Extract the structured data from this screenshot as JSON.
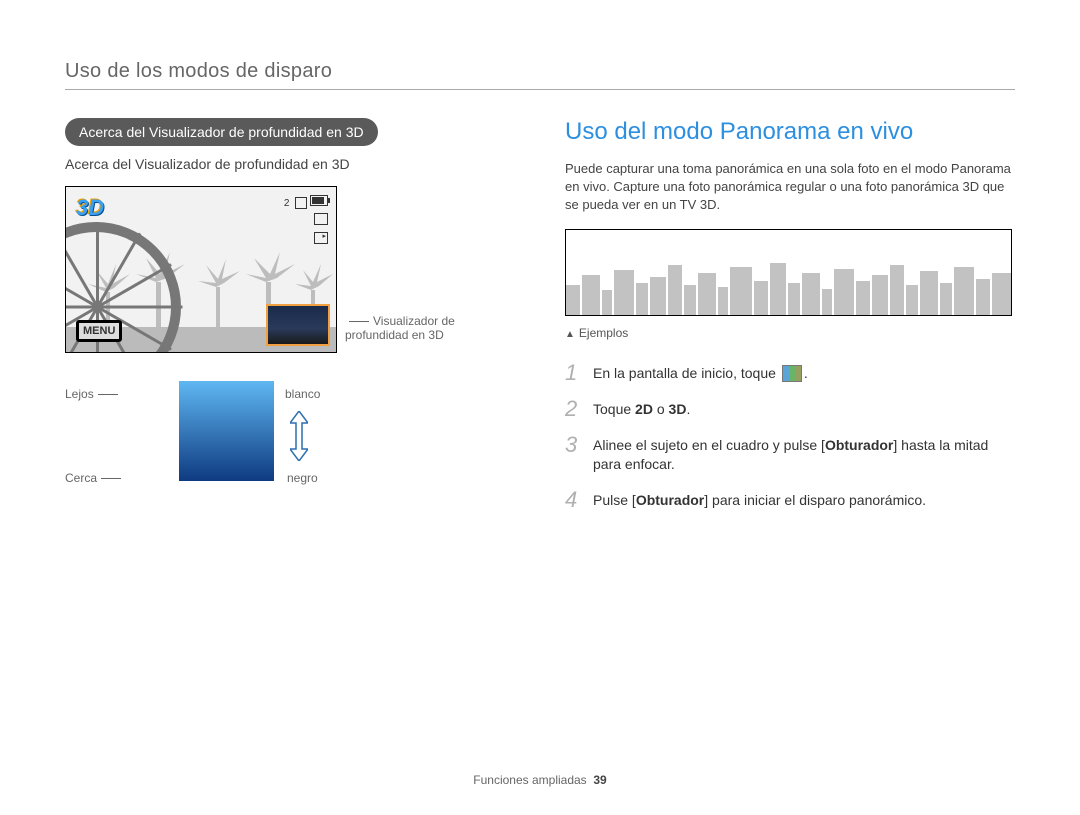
{
  "header": "Uso de los modos de disparo",
  "left": {
    "pill": "Acerca del Visualizador de profundidad en 3D",
    "subhead": "Acerca del Visualizador de profundidad en 3D",
    "preview": {
      "count_label": "2",
      "menu_label": "MENU",
      "annotation": "Visualizador de profundidad en 3D"
    },
    "gradient": {
      "lejos": "Lejos",
      "cerca": "Cerca",
      "blanco": "blanco",
      "negro": "negro"
    }
  },
  "right": {
    "title": "Uso del modo Panorama en vivo",
    "para": "Puede capturar una toma panorámica en una sola foto en el modo Panorama en vivo. Capture una foto panorámica regular o una foto panorámica 3D que se pueda ver en un TV 3D.",
    "examples_label": "Ejemplos",
    "steps": [
      {
        "n": "1",
        "pre": "En la pantalla de inicio, toque ",
        "icon": true,
        "post": "."
      },
      {
        "n": "2",
        "pre": "Toque ",
        "bold": "2D",
        "mid": " o ",
        "bold2": "3D",
        "post": "."
      },
      {
        "n": "3",
        "pre": "Alinee el sujeto en el cuadro y pulse [",
        "bold": "Obturador",
        "post": "] hasta la mitad para enfocar."
      },
      {
        "n": "4",
        "pre": "Pulse [",
        "bold": "Obturador",
        "post": "] para iniciar el disparo panorámico."
      }
    ]
  },
  "footer": {
    "section": "Funciones ampliadas",
    "page": "39"
  }
}
